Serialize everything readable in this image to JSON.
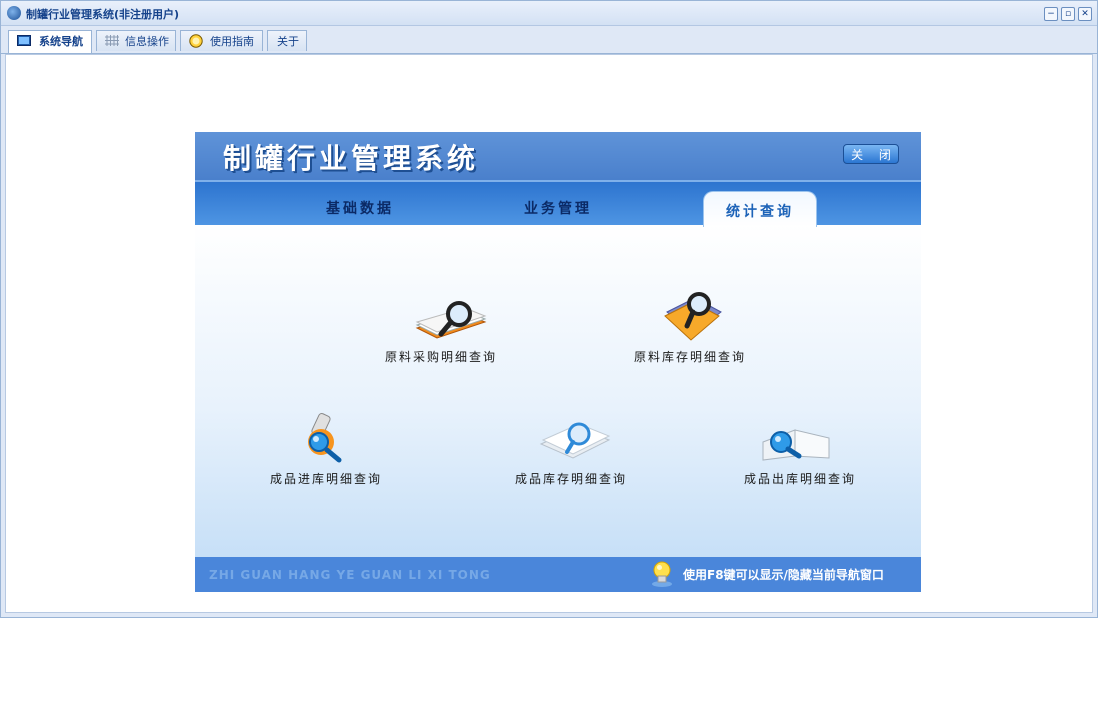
{
  "window": {
    "title": "制罐行业管理系统(非注册用户)",
    "minimize": "−",
    "restore": "▫",
    "close": "✕"
  },
  "top_tabs": [
    {
      "label": "系统导航",
      "icon": "monitor-icon",
      "active": true
    },
    {
      "label": "信息操作",
      "icon": "grid-icon",
      "active": false
    },
    {
      "label": "使用指南",
      "icon": "clock-icon",
      "active": false
    },
    {
      "label": "关于",
      "icon": "",
      "active": false
    }
  ],
  "panel": {
    "title": "制罐行业管理系统",
    "close_label": "关 闭",
    "tabs": [
      {
        "label": "基础数据",
        "active": false
      },
      {
        "label": "业务管理",
        "active": false
      },
      {
        "label": "统计查询",
        "active": true
      }
    ],
    "items": [
      {
        "label": "原料采购明细查询",
        "icon": "book-search-icon"
      },
      {
        "label": "原料库存明细查询",
        "icon": "folder-search-icon"
      },
      {
        "label": "成品进库明细查询",
        "icon": "scroll-search-icon"
      },
      {
        "label": "成品库存明细查询",
        "icon": "document-search-icon"
      },
      {
        "label": "成品出库明细查询",
        "icon": "open-book-search-icon"
      }
    ],
    "footer_slogan": "ZHI GUAN HANG YE GUAN LI XI TONG",
    "footer_hint": "使用F8键可以显示/隐藏当前导航窗口"
  },
  "colors": {
    "accent": "#4a86da",
    "tab_bar": "#2d74cf",
    "active_tab_text": "#1d63b8"
  }
}
